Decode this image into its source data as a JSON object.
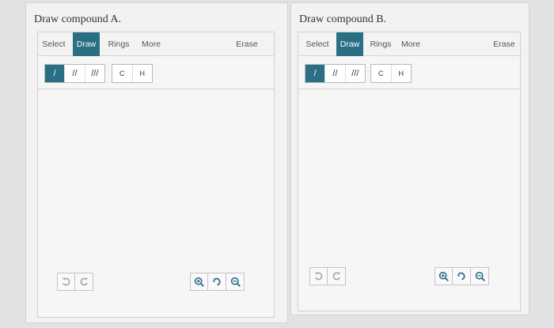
{
  "panels": [
    {
      "title": "Draw compound A.",
      "tabs": [
        "Select",
        "Draw",
        "Rings",
        "More"
      ],
      "erase_label": "Erase",
      "bonds": [
        "/",
        "//",
        "///"
      ],
      "atoms": [
        "C",
        "H"
      ]
    },
    {
      "title": "Draw compound B.",
      "tabs": [
        "Select",
        "Draw",
        "Rings",
        "More"
      ],
      "erase_label": "Erase",
      "bonds": [
        "/",
        "//",
        "///"
      ],
      "atoms": [
        "C",
        "H"
      ]
    }
  ],
  "colors": {
    "accent": "#2a6f84",
    "icon": "#2a6f84",
    "disabled_icon": "#9aa9ae"
  },
  "icons": [
    "undo-icon",
    "redo-icon",
    "zoom-in-icon",
    "reset-zoom-icon",
    "zoom-out-icon"
  ]
}
